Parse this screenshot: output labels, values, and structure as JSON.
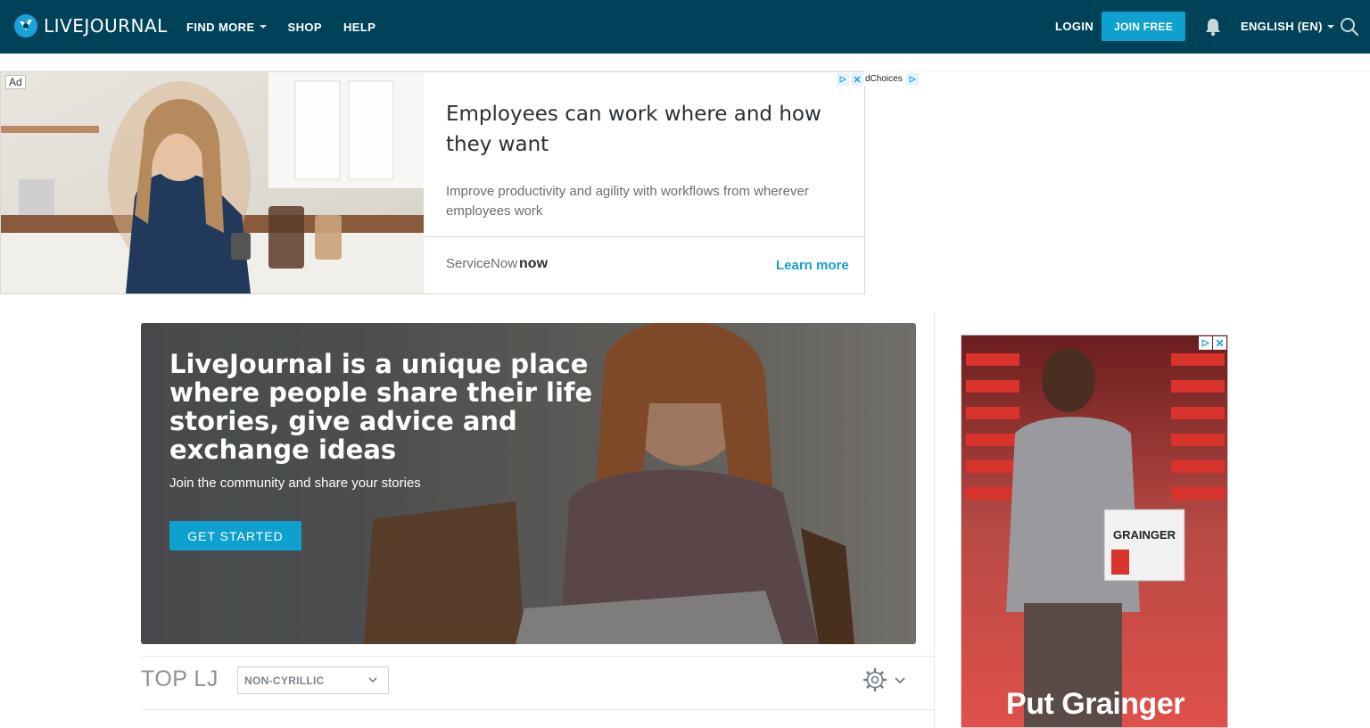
{
  "header": {
    "logo_text": "LIVEJOURNAL",
    "nav": {
      "find_more": "FIND MORE",
      "shop": "SHOP",
      "help": "HELP"
    },
    "login": "LOGIN",
    "join": "JOIN FREE",
    "language": "ENGLISH (EN)"
  },
  "top_ad": {
    "badge": "Ad",
    "title": "Employees can work where and how they want",
    "description": "Improve productivity and agility with workflows from wherever employees work",
    "brand_prefix": "ServiceNow",
    "brand_logo": "now",
    "cta": "Learn more",
    "adchoices": "dChoices"
  },
  "hero": {
    "title": "LiveJournal is a unique place where people share their life stories, give advice and exchange ideas",
    "subtitle": "Join the community and share your stories",
    "button": "GET STARTED"
  },
  "top_lj": {
    "title": "TOP LJ",
    "filter_value": "NON-CYRILLIC"
  },
  "side_ad": {
    "headline": "Put Grainger",
    "box_label": "GRAINGER"
  },
  "colors": {
    "header_bg": "#004359",
    "accent": "#0ea0cf",
    "link": "#1a9ed8"
  }
}
